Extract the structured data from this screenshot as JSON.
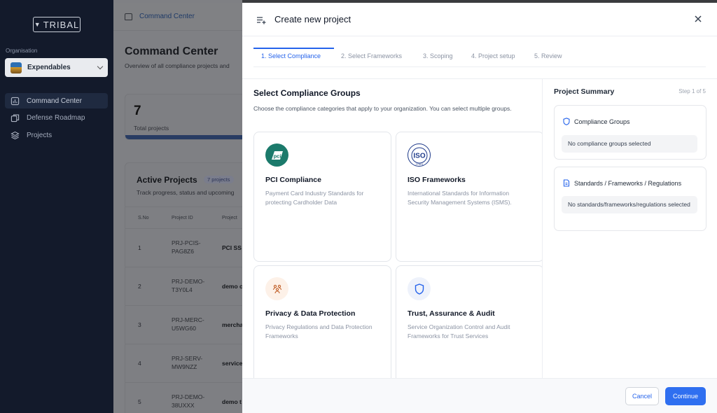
{
  "app": {
    "logo_text": "TRIBAL",
    "org_label": "Organisation",
    "org_name": "Expendables"
  },
  "sidebar": {
    "items": [
      {
        "label": "Command Center",
        "icon": "chart-box-icon",
        "active": true
      },
      {
        "label": "Defense Roadmap",
        "icon": "roadmap-icon",
        "active": false
      },
      {
        "label": "Projects",
        "icon": "layers-icon",
        "active": false
      }
    ]
  },
  "background_page": {
    "breadcrumb": "Command Center",
    "title": "Command Center",
    "subtitle": "Overview of all compliance projects and",
    "stat": {
      "value": "7",
      "label": "Total projects"
    },
    "active_projects": {
      "title": "Active Projects",
      "badge": "7 projects",
      "subtitle": "Track progress, status and upcoming",
      "columns": [
        "S.No",
        "Project ID",
        "Project"
      ],
      "rows": [
        {
          "sno": "1",
          "id": "PRJ-PCIS-PAG8Z6",
          "name": "PCI SS"
        },
        {
          "sno": "2",
          "id": "PRJ-DEMO-T3Y0L4",
          "name": "demo c"
        },
        {
          "sno": "3",
          "id": "PRJ-MERC-U5WG60",
          "name": "mercha"
        },
        {
          "sno": "4",
          "id": "PRJ-SERV-MW9NZZ",
          "name": "service"
        },
        {
          "sno": "5",
          "id": "PRJ-DEMO-38UXXX",
          "name": "demo t"
        }
      ]
    }
  },
  "modal": {
    "title": "Create new project",
    "steps": [
      "1. Select Compliance",
      "2. Select Frameworks",
      "3. Scoping",
      "4. Project setup",
      "5. Review"
    ],
    "active_step": 0,
    "section_title": "Select Compliance Groups",
    "section_desc": "Choose the compliance categories that apply to your organization. You can select multiple groups.",
    "cards": [
      {
        "title": "PCI Compliance",
        "desc": "Payment Card Industry Standards for protecting Cardholder Data",
        "icon": "pci-logo-icon",
        "icon_text": "pci"
      },
      {
        "title": "ISO Frameworks",
        "desc": "International Standards for Information Security Management Systems (ISMS).",
        "icon": "iso-logo-icon",
        "icon_text": "ISO",
        "icon_subtext": "27001"
      },
      {
        "title": "Privacy & Data Protection",
        "desc": "Privacy Regulations and Data Protection Frameworks",
        "icon": "people-icon"
      },
      {
        "title": "Trust, Assurance & Audit",
        "desc": "Service Organization Control and Audit Frameworks for Trust Services",
        "icon": "shield-icon"
      }
    ],
    "summary": {
      "title": "Project Summary",
      "step_indicator": "Step 1 of 5",
      "compliance_label": "Compliance Groups",
      "compliance_empty": "No compliance groups selected",
      "standards_label": "Standards / Frameworks / Regulations",
      "standards_empty": "No standards/frameworks/regulations selected"
    },
    "footer": {
      "cancel": "Cancel",
      "continue": "Continue"
    }
  },
  "colors": {
    "accent": "#2563eb",
    "sidebar_bg": "#131a2b",
    "pci_green": "#1b7a6b",
    "privacy_orange": "#c2612b"
  }
}
